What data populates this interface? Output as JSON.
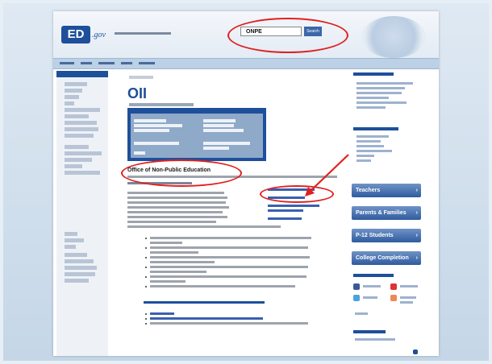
{
  "header": {
    "logo_ed": "ED",
    "logo_gov": ".gov",
    "search_value": "ONPE",
    "search_button": "Search"
  },
  "main": {
    "title": "OII",
    "section_title": "Office of Non-Public Education"
  },
  "right_sidebar": {
    "buttons": [
      "Teachers",
      "Parents & Families",
      "P-12 Students",
      "College Completion"
    ]
  },
  "colors": {
    "accent": "#1e4f9a",
    "annotation_red": "#e02020",
    "sidebar_button": "#2f5b9f"
  },
  "icons": [
    "search-icon",
    "chevron-right-icon",
    "facebook-icon",
    "twitter-icon",
    "youtube-icon",
    "rss-icon"
  ]
}
